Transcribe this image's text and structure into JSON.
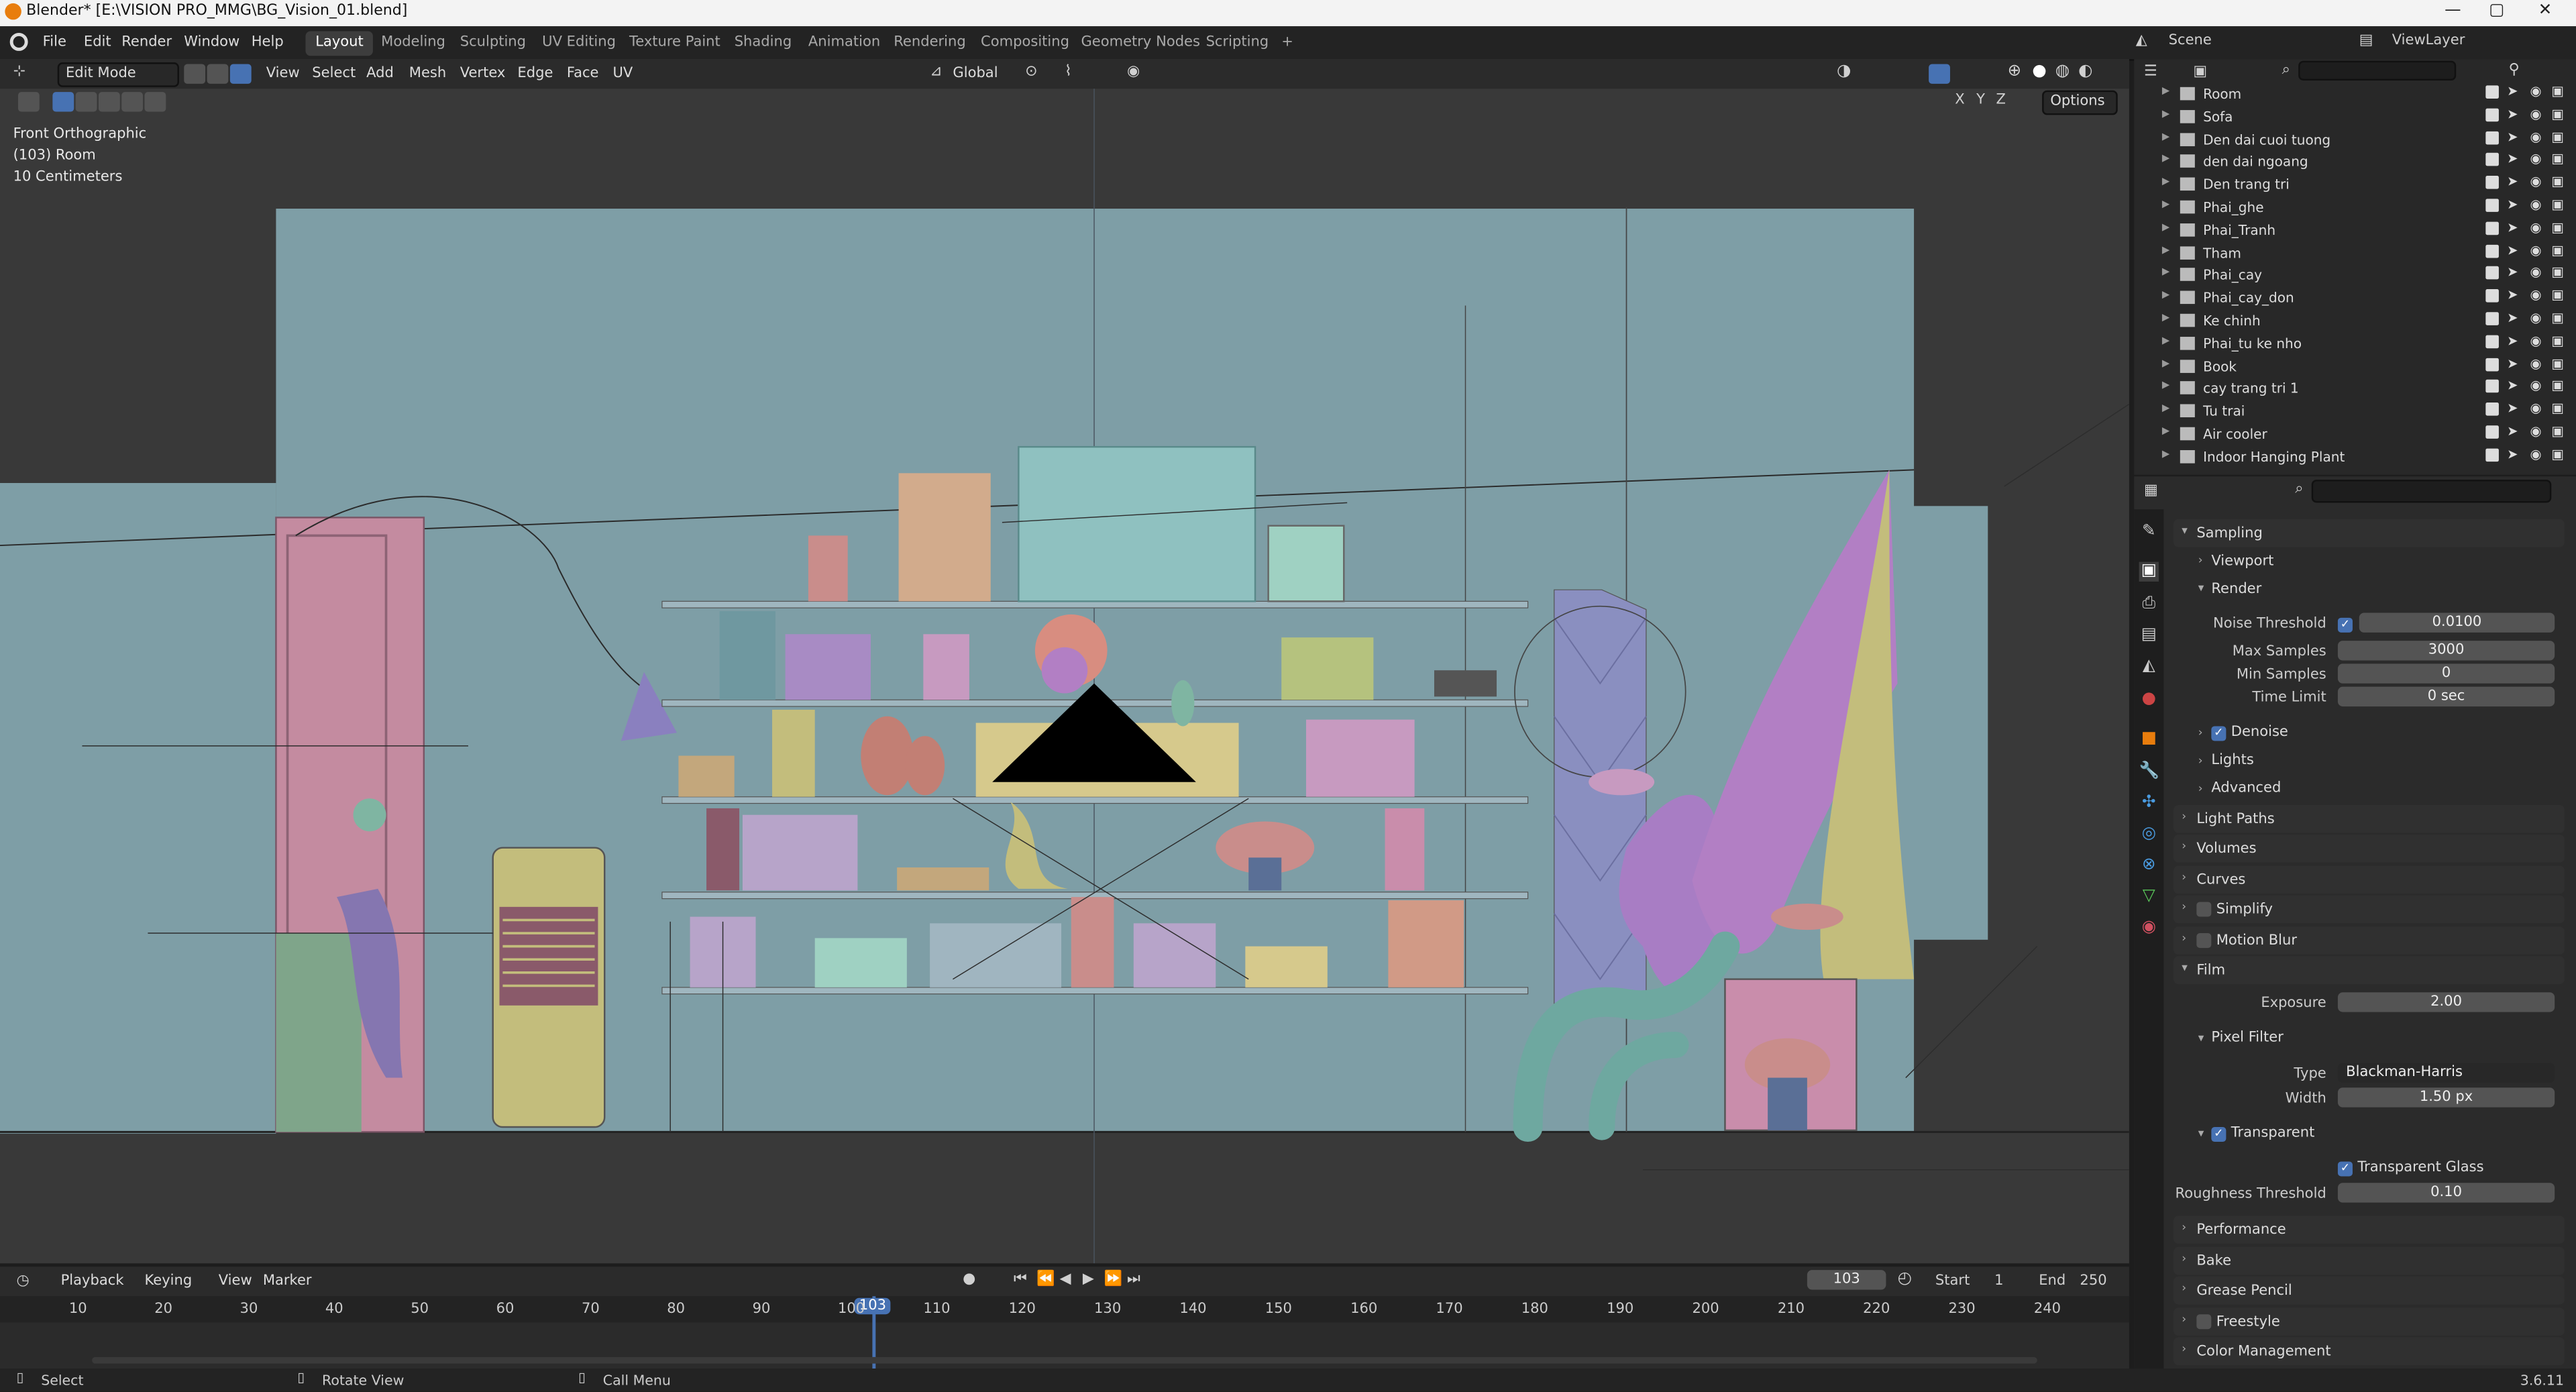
{
  "window": {
    "title": "Blender* [E:\\VISION PRO_MMG\\BG_Vision_01.blend]",
    "minimize": "—",
    "maximize": "▢",
    "close": "✕"
  },
  "menu": [
    "File",
    "Edit",
    "Render",
    "Window",
    "Help"
  ],
  "workspaces": [
    "Layout",
    "Modeling",
    "Sculpting",
    "UV Editing",
    "Texture Paint",
    "Shading",
    "Animation",
    "Rendering",
    "Compositing",
    "Geometry Nodes",
    "Scripting",
    "+"
  ],
  "active_workspace": "Layout",
  "scene": {
    "label": "Scene",
    "view_layer": "ViewLayer"
  },
  "viewport_header": {
    "mode": "Edit Mode",
    "menus": [
      "View",
      "Select",
      "Add",
      "Mesh",
      "Vertex",
      "Edge",
      "Face",
      "UV"
    ],
    "transform_orientation": "Global",
    "options": "Options",
    "axes": [
      "X",
      "Y",
      "Z"
    ]
  },
  "viewport_overlay": {
    "view": "Front Orthographic",
    "object": "(103) Room",
    "scale": "10 Centimeters"
  },
  "outliner": {
    "search_placeholder": "",
    "items": [
      "Room",
      "Sofa",
      "Den dai cuoi tuong",
      "den dai ngoang",
      "Den trang tri",
      "Phai_ghe",
      "Phai_Tranh",
      "Tham",
      "Phai_cay",
      "Phai_cay_don",
      "Ke chinh",
      "Phai_tu ke nho",
      "Book",
      "cay trang tri 1",
      "Tu trai",
      "Air cooler",
      "Indoor Hanging Plant"
    ]
  },
  "properties": {
    "sampling": "Sampling",
    "viewport": "Viewport",
    "render": "Render",
    "noise_threshold_label": "Noise Threshold",
    "noise_threshold": "0.0100",
    "max_samples_label": "Max Samples",
    "max_samples": "3000",
    "min_samples_label": "Min Samples",
    "min_samples": "0",
    "time_limit_label": "Time Limit",
    "time_limit": "0 sec",
    "denoise": "Denoise",
    "lights": "Lights",
    "advanced": "Advanced",
    "light_paths": "Light Paths",
    "volumes": "Volumes",
    "curves": "Curves",
    "simplify": "Simplify",
    "motion_blur": "Motion Blur",
    "film": "Film",
    "exposure_label": "Exposure",
    "exposure": "2.00",
    "pixel_filter": "Pixel Filter",
    "type_label": "Type",
    "type": "Blackman-Harris",
    "width_label": "Width",
    "width": "1.50 px",
    "transparent": "Transparent",
    "transparent_glass": "Transparent Glass",
    "roughness_label": "Roughness Threshold",
    "roughness": "0.10",
    "performance": "Performance",
    "bake": "Bake",
    "grease_pencil": "Grease Pencil",
    "freestyle": "Freestyle",
    "color_management": "Color Management"
  },
  "timeline": {
    "menus": [
      "Playback",
      "Keying",
      "View",
      "Marker"
    ],
    "current_frame": "103",
    "start_label": "Start",
    "start": "1",
    "end_label": "End",
    "end": "250",
    "ticks": [
      "10",
      "20",
      "30",
      "40",
      "50",
      "60",
      "70",
      "80",
      "90",
      "100",
      "110",
      "120",
      "130",
      "140",
      "150",
      "160",
      "170",
      "180",
      "190",
      "200",
      "210",
      "220",
      "230",
      "240"
    ]
  },
  "statusbar": {
    "select": "Select",
    "rotate": "Rotate View",
    "call_menu": "Call Menu",
    "version": "3.6.11"
  },
  "colors": {
    "accent": "#4772b3",
    "room_wall": "#7e9ea6",
    "door": "#c48ba0",
    "frame_marker": "#4772b3"
  }
}
